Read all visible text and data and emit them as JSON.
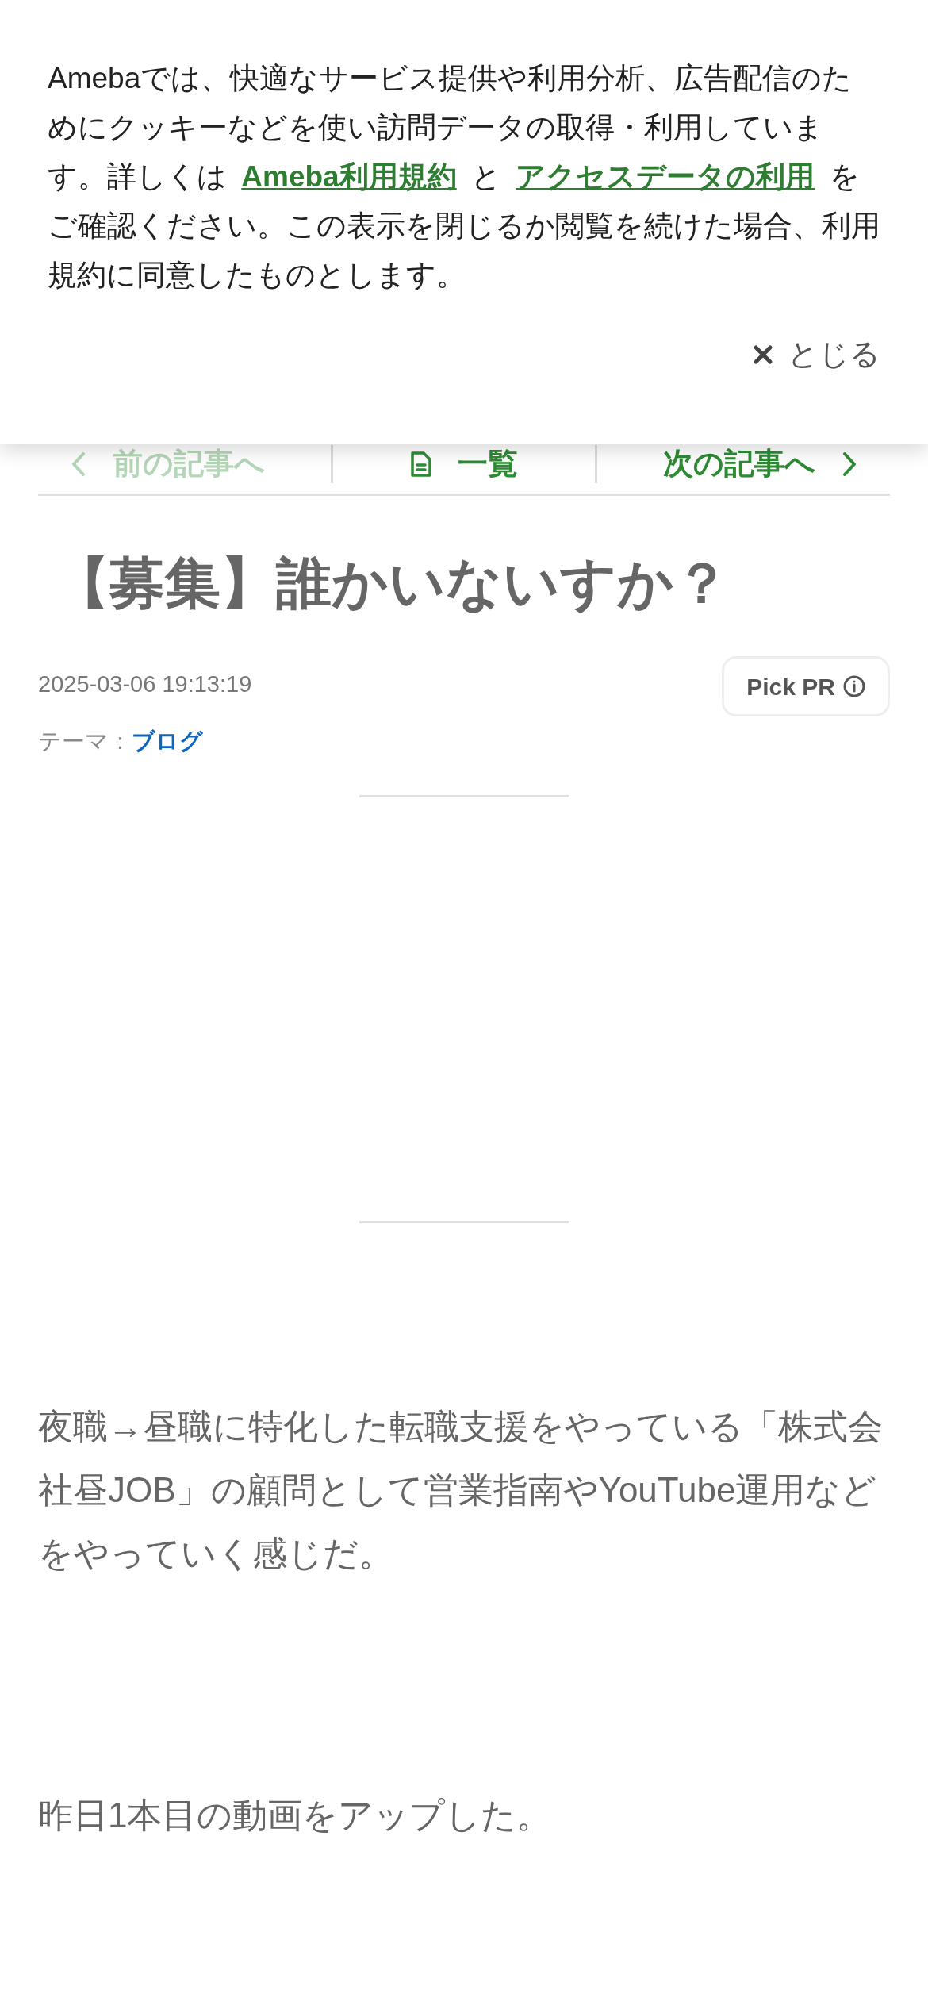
{
  "cookie_notice": {
    "parts": [
      {
        "kind": "text",
        "text": "Amebaでは、快適なサービス提供や利用分析、広告配信のためにクッキーなどを使い訪問データの取得・利用しています。詳しくは "
      },
      {
        "kind": "link",
        "text": "Ameba利用規約"
      },
      {
        "kind": "text",
        "text": " と "
      },
      {
        "kind": "link",
        "text": "アクセスデータの利用"
      },
      {
        "kind": "text",
        "text": " をご確認ください。この表示を閉じるか閲覧を続けた場合、利用規約に同意したものとします。"
      }
    ],
    "close_label": "とじる"
  },
  "article_nav": [
    {
      "kind": "prev",
      "label": "前の記事へ",
      "disabled": true
    },
    {
      "kind": "list",
      "label": "一覧",
      "disabled": false
    },
    {
      "kind": "next",
      "label": "次の記事へ",
      "disabled": false
    }
  ],
  "article": {
    "title": "【募集】誰かいないすか？",
    "date": "2025-03-06 19:13:19",
    "pick_pr": "Pick PR",
    "theme_label": "テーマ：",
    "theme": "ブログ",
    "paragraphs": [
      "夜職→昼職に特化した転職支援をやっている「株式会社昼JOB」の顧問として営業指南やYouTube運用などをやっていく感じだ。",
      "昨日1本目の動画をアップした。"
    ]
  }
}
